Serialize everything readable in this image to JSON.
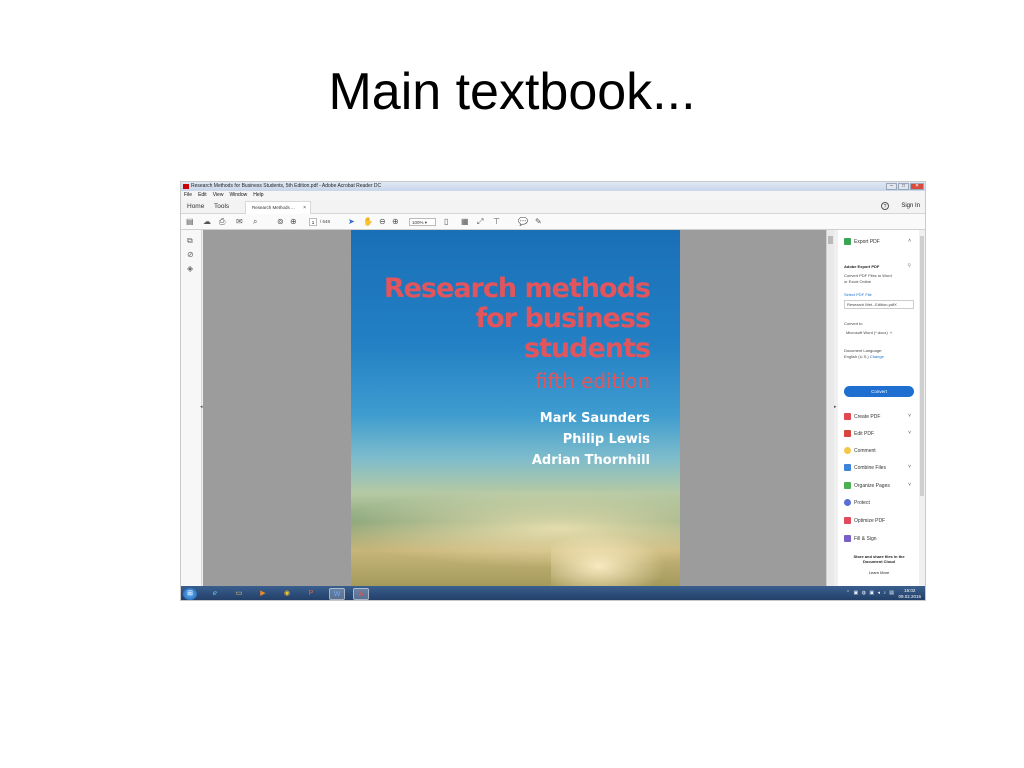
{
  "slide": {
    "title": "Main textbook..."
  },
  "window": {
    "title": "Research Methods for Business Students, 5th Edition.pdf - Adobe Acrobat Reader DC",
    "menu": [
      "File",
      "Edit",
      "View",
      "Window",
      "Help"
    ],
    "nav": {
      "home": "Home",
      "tools": "Tools"
    },
    "tab_label": "Research Methods ...",
    "help_glyph": "?",
    "sign_in": "Sign In"
  },
  "toolbar": {
    "page_current": "1",
    "page_total": "/ 648",
    "zoom": "100%",
    "icons": [
      "save-icon",
      "cloud-upload-icon",
      "print-icon",
      "email-icon",
      "search-icon",
      "prev-page-icon",
      "next-page-icon",
      "select-cursor-icon",
      "hand-icon",
      "zoom-out-icon",
      "zoom-in-icon",
      "fit-page-icon",
      "scroll-mode-icon",
      "fullscreen-icon",
      "tools-icon",
      "comment-icon",
      "sign-icon"
    ]
  },
  "book": {
    "title_lines": [
      "Research methods",
      "for business",
      "students"
    ],
    "edition": "fifth edition",
    "authors": [
      "Mark Saunders",
      "Philip Lewis",
      "Adrian Thornhill"
    ]
  },
  "right_panel": {
    "export_pdf": "Export PDF",
    "heading": "Adobe Export PDF",
    "description_lines": [
      "Convert PDF Files to Word",
      "or Excel Online"
    ],
    "select_file_label": "Select PDF File",
    "selected_file": "Research Met...Edition.pdfX",
    "convert_to_label": "Convert to",
    "convert_to_value": "Microsoft Word (*.docx)",
    "language_label": "Document Language:",
    "language_value": "English (U.S.)",
    "change_link": "Change",
    "convert_button": "Convert",
    "tools": [
      {
        "label": "Create PDF",
        "icon": "create-pdf-icon",
        "color": "#e34850",
        "chevron": true
      },
      {
        "label": "Edit PDF",
        "icon": "edit-pdf-icon",
        "color": "#d9453d",
        "chevron": true
      },
      {
        "label": "Comment",
        "icon": "comment-icon",
        "color": "#f3c845",
        "chevron": false
      },
      {
        "label": "Combine Files",
        "icon": "combine-files-icon",
        "color": "#3d85d8",
        "chevron": true
      },
      {
        "label": "Organize Pages",
        "icon": "organize-pages-icon",
        "color": "#4caf50",
        "chevron": true
      },
      {
        "label": "Protect",
        "icon": "protect-icon",
        "color": "#5a6fd6",
        "chevron": false
      },
      {
        "label": "Optimize PDF",
        "icon": "optimize-pdf-icon",
        "color": "#e04b5c",
        "chevron": false
      },
      {
        "label": "Fill & Sign",
        "icon": "fill-sign-icon",
        "color": "#7a5fc6",
        "chevron": false
      }
    ],
    "cloud_lines": [
      "Store and share files in the",
      "Document Cloud"
    ],
    "learn_more": "Learn More"
  },
  "taskbar": {
    "clock_time": "15:02",
    "clock_date": "09.02.2016"
  }
}
